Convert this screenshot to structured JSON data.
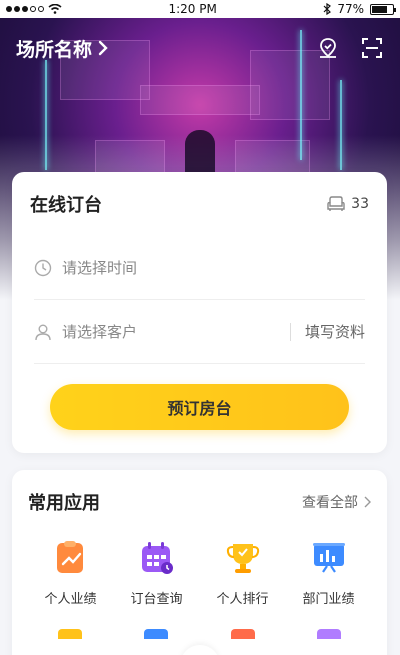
{
  "status_bar": {
    "time": "1:20 PM",
    "battery": "77%",
    "battery_level": 0.77
  },
  "header": {
    "venue_name": "场所名称",
    "location_icon": "location-icon",
    "scan_icon": "scan-icon"
  },
  "booking": {
    "title": "在线订台",
    "table_count": "33",
    "time_placeholder": "请选择时间",
    "customer_placeholder": "请选择客户",
    "fill_info_link": "填写资料",
    "book_button": "预订房台"
  },
  "apps": {
    "title": "常用应用",
    "view_all": "查看全部",
    "items": [
      {
        "label": "个人业绩",
        "icon": "personal-performance-icon"
      },
      {
        "label": "订台查询",
        "icon": "booking-query-icon"
      },
      {
        "label": "个人排行",
        "icon": "personal-ranking-icon"
      },
      {
        "label": "部门业绩",
        "icon": "department-performance-icon"
      }
    ]
  },
  "colors": {
    "accent_yellow": "#ffcc1a",
    "hero_purple": "#6a1f8e"
  }
}
